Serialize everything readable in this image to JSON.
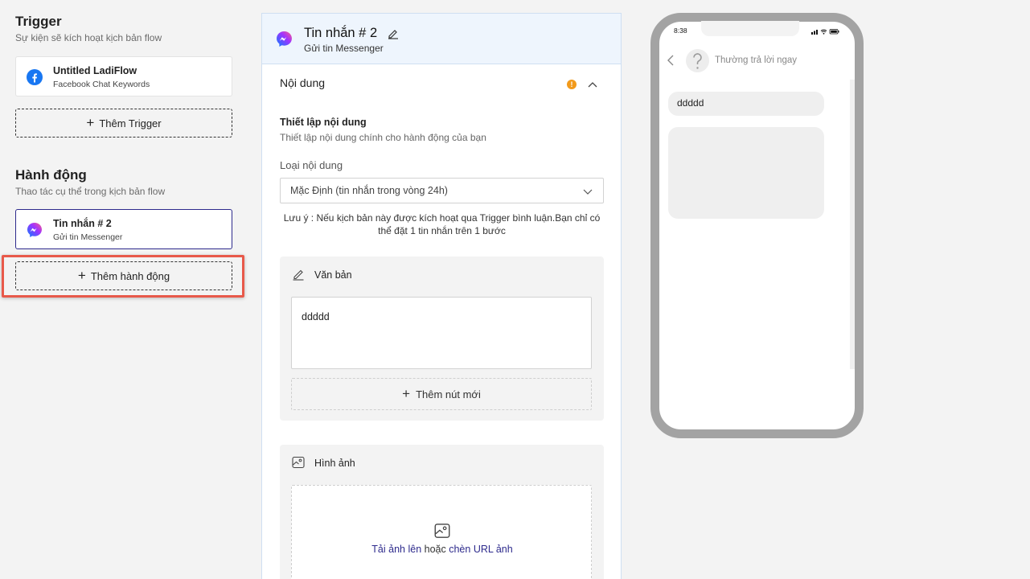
{
  "trigger": {
    "title": "Trigger",
    "subtitle": "Sự kiện sẽ kích hoạt kịch bản flow",
    "card": {
      "name": "Untitled LadiFlow",
      "type": "Facebook Chat Keywords",
      "icon": "facebook-icon"
    },
    "add_label": "Thêm Trigger"
  },
  "actions": {
    "title": "Hành động",
    "subtitle": "Thao tác cụ thể trong kịch bản flow",
    "card": {
      "name": "Tin nhắn # 2",
      "type": "Gửi tin Messenger",
      "icon": "messenger-icon"
    },
    "add_label": "Thêm hành động"
  },
  "editor": {
    "title": "Tin nhắn # 2",
    "subtitle": "Gửi tin Messenger",
    "section_title": "Nội dung",
    "warning_badge": "!",
    "setup_title": "Thiết lập nội dung",
    "setup_desc": "Thiết lập nội dung chính cho hành động của bạn",
    "content_type_label": "Loại nội dung",
    "content_type_value": "Mặc Định (tin nhắn trong vòng 24h)",
    "note": "Lưu ý : Nếu kịch bản này được kích hoạt qua Trigger bình luận.Bạn chỉ có thể đặt 1 tin nhắn trên 1 bước",
    "text_block": {
      "title": "Văn bản",
      "value": "ddddd",
      "add_button_label": "Thêm nút mới"
    },
    "image_block": {
      "title": "Hình ảnh",
      "upload_link": "Tải ảnh lên",
      "upload_or": "hoặc",
      "url_link": "chèn URL ảnh"
    }
  },
  "preview": {
    "time": "8:38",
    "page_status": "Thường trả lời ngay",
    "message_text": "ddddd"
  },
  "colors": {
    "accent": "#2d2a8c",
    "highlight": "#e8594a",
    "warning": "#f29a1b",
    "facebook": "#1877f2"
  }
}
